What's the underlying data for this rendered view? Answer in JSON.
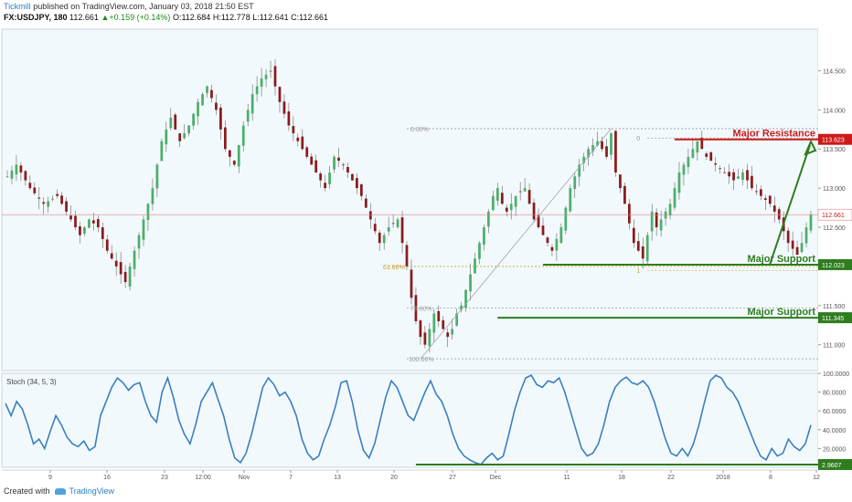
{
  "header": {
    "author": "Tickmill",
    "published": "published on TradingView.com, January 03, 2018 21:50 EST",
    "symbol": "FX:USDJPY, 180",
    "last": "112.661",
    "change": "+0.159 (+0.14%)",
    "open": "O:112.684",
    "high": "H:112.778",
    "low": "L:112.641",
    "close": "C:112.661"
  },
  "footer": {
    "created_with": "Created with",
    "brand": "TradingView"
  },
  "colors": {
    "up": "#4caf6a",
    "down": "#8b1a1a",
    "green": "#2e7d1e",
    "red": "#cc1a1a",
    "stoch": "#3a7fc0",
    "fib": "#999999",
    "fib618": "#c8a030",
    "bg": "#f2f9fd"
  },
  "chart_data": [
    {
      "type": "candlestick",
      "ylim": [
        110.67,
        115.03
      ],
      "yticks": [
        "114.500",
        "114.000",
        "113.500",
        "113.000",
        "112.500",
        "112.000",
        "111.500",
        "111.000"
      ],
      "xticks": [
        "9",
        "16",
        "23",
        "12:00",
        "Nov",
        "7",
        "13",
        "20",
        "27",
        "Dec",
        "11",
        "18",
        "22",
        "2018",
        "8",
        "12"
      ],
      "last_price": 112.661,
      "last_price_label": "112.661",
      "fib_levels": [
        {
          "label": "0.00%",
          "value": 113.76
        },
        {
          "label": "61.80%",
          "value": 112.0
        },
        {
          "label": "78.60%",
          "value": 111.47
        },
        {
          "label": "100.00%",
          "value": 110.82
        }
      ],
      "fib_extension": [
        {
          "label": "0"
        },
        {
          "label": "1"
        }
      ],
      "levels": [
        {
          "name": "Major Resistance",
          "value": 113.623,
          "label": "113.623",
          "color": "red"
        },
        {
          "name": "Major Support",
          "value": 112.023,
          "label": "112.023",
          "color": "green"
        },
        {
          "name": "Major Support",
          "value": 111.345,
          "label": "111.345",
          "color": "green"
        }
      ],
      "close_path": [
        [
          0,
          113.15
        ],
        [
          2,
          113.3
        ],
        [
          5,
          113.0
        ],
        [
          8,
          112.8
        ],
        [
          11,
          112.9
        ],
        [
          13,
          112.7
        ],
        [
          16,
          112.4
        ],
        [
          18,
          112.6
        ],
        [
          20,
          112.5
        ],
        [
          22,
          112.2
        ],
        [
          24,
          112.0
        ],
        [
          26,
          111.8
        ],
        [
          27,
          112.0
        ],
        [
          28,
          112.2
        ],
        [
          30,
          112.6
        ],
        [
          32,
          113.0
        ],
        [
          34,
          113.6
        ],
        [
          36,
          113.9
        ],
        [
          38,
          113.6
        ],
        [
          40,
          113.8
        ],
        [
          42,
          114.1
        ],
        [
          44,
          114.3
        ],
        [
          46,
          114.0
        ],
        [
          48,
          113.5
        ],
        [
          50,
          113.3
        ],
        [
          52,
          113.8
        ],
        [
          54,
          114.2
        ],
        [
          56,
          114.4
        ],
        [
          58,
          114.5
        ],
        [
          60,
          114.1
        ],
        [
          62,
          113.8
        ],
        [
          64,
          113.6
        ],
        [
          66,
          113.4
        ],
        [
          68,
          113.2
        ],
        [
          70,
          113.0
        ],
        [
          72,
          113.4
        ],
        [
          74,
          113.3
        ],
        [
          76,
          113.1
        ],
        [
          78,
          112.9
        ],
        [
          80,
          112.6
        ],
        [
          82,
          112.3
        ],
        [
          84,
          112.5
        ],
        [
          86,
          112.6
        ],
        [
          87,
          112.3
        ],
        [
          88,
          112.0
        ],
        [
          89,
          111.6
        ],
        [
          90,
          111.3
        ],
        [
          91,
          111.1
        ],
        [
          92,
          111.0
        ],
        [
          93,
          111.2
        ],
        [
          94,
          111.4
        ],
        [
          95,
          111.3
        ],
        [
          96,
          111.2
        ],
        [
          97,
          111.1
        ],
        [
          98,
          111.2
        ],
        [
          99,
          111.4
        ],
        [
          100,
          111.5
        ],
        [
          101,
          111.7
        ],
        [
          102,
          111.9
        ],
        [
          103,
          112.1
        ],
        [
          104,
          112.3
        ],
        [
          105,
          112.5
        ],
        [
          106,
          112.7
        ],
        [
          107,
          112.9
        ],
        [
          108,
          113.0
        ],
        [
          109,
          112.8
        ],
        [
          110,
          112.7
        ],
        [
          112,
          112.9
        ],
        [
          114,
          113.0
        ],
        [
          116,
          112.6
        ],
        [
          118,
          112.4
        ],
        [
          120,
          112.2
        ],
        [
          122,
          112.5
        ],
        [
          124,
          113.0
        ],
        [
          126,
          113.3
        ],
        [
          128,
          113.5
        ],
        [
          130,
          113.6
        ],
        [
          132,
          113.4
        ],
        [
          133,
          113.7
        ],
        [
          134,
          113.2
        ],
        [
          136,
          112.8
        ],
        [
          138,
          112.3
        ],
        [
          140,
          112.1
        ],
        [
          141,
          112.4
        ],
        [
          142,
          112.7
        ],
        [
          143,
          112.5
        ],
        [
          144,
          112.6
        ],
        [
          146,
          112.8
        ],
        [
          148,
          113.2
        ],
        [
          150,
          113.4
        ],
        [
          152,
          113.6
        ],
        [
          154,
          113.4
        ],
        [
          156,
          113.3
        ],
        [
          158,
          113.2
        ],
        [
          160,
          113.1
        ],
        [
          162,
          113.2
        ],
        [
          164,
          113.0
        ],
        [
          166,
          112.9
        ],
        [
          168,
          112.8
        ],
        [
          170,
          112.6
        ],
        [
          172,
          112.3
        ],
        [
          174,
          112.15
        ],
        [
          175,
          112.3
        ],
        [
          176,
          112.5
        ],
        [
          177,
          112.66
        ]
      ]
    },
    {
      "type": "line",
      "title": "Stoch (34, 5, 3)",
      "ylim": [
        0,
        100
      ],
      "yticks": [
        "100.0000",
        "80.0000",
        "60.0000",
        "40.0000",
        "20.0000"
      ],
      "last_value_label": "2.9607",
      "support_level": 2.9607,
      "series": [
        {
          "values": [
            68,
            55,
            70,
            62,
            45,
            25,
            30,
            20,
            38,
            55,
            45,
            32,
            25,
            22,
            28,
            18,
            22,
            55,
            70,
            85,
            95,
            90,
            82,
            88,
            90,
            70,
            55,
            48,
            80,
            95,
            75,
            50,
            35,
            25,
            45,
            70,
            80,
            90,
            72,
            55,
            30,
            10,
            5,
            15,
            35,
            60,
            85,
            95,
            88,
            76,
            80,
            70,
            55,
            30,
            15,
            8,
            12,
            30,
            45,
            65,
            90,
            92,
            70,
            40,
            18,
            10,
            25,
            50,
            75,
            92,
            85,
            70,
            55,
            50,
            65,
            80,
            92,
            78,
            70,
            55,
            35,
            20,
            12,
            8,
            5,
            3,
            10,
            15,
            8,
            12,
            35,
            60,
            80,
            95,
            98,
            88,
            85,
            92,
            90,
            95,
            80,
            60,
            40,
            20,
            12,
            15,
            25,
            45,
            70,
            85,
            92,
            96,
            90,
            88,
            92,
            85,
            70,
            50,
            30,
            15,
            12,
            20,
            12,
            25,
            45,
            70,
            92,
            98,
            95,
            85,
            80,
            70,
            55,
            40,
            25,
            12,
            8,
            20,
            12,
            15,
            30,
            22,
            18,
            25,
            45
          ]
        }
      ]
    }
  ]
}
